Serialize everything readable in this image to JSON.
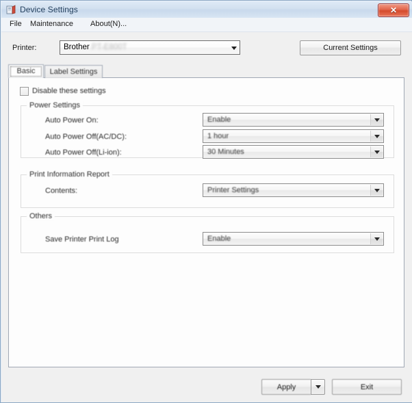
{
  "window": {
    "title": "Device Settings",
    "icon": "printer-icon",
    "close_label": "✕",
    "accent_close_color": "#d44a2d",
    "frame_border_color": "#8ba7c4"
  },
  "menubar": {
    "items": [
      {
        "label": "File",
        "mnemonic": "F"
      },
      {
        "label": "Maintenance",
        "mnemonic": "M"
      },
      {
        "label": "About(N)...",
        "mnemonic": "N"
      }
    ]
  },
  "printer_row": {
    "label": "Printer:",
    "selected": "Brother",
    "model": "PT-E800T",
    "current_settings_button": "Current Settings"
  },
  "tabs": [
    {
      "label": "Basic",
      "selected": true
    },
    {
      "label": "Label Settings",
      "selected": false
    }
  ],
  "panel": {
    "disable_checkbox": {
      "label": "Disable these settings",
      "checked": false
    },
    "groups": [
      {
        "title": "Power Settings",
        "fields": [
          {
            "label": "Auto Power On:",
            "value": "Enable"
          },
          {
            "label": "Auto Power Off(AC/DC):",
            "value": "1 hour"
          },
          {
            "label": "Auto Power Off(Li-ion):",
            "value": "30 Minutes"
          }
        ]
      },
      {
        "title": "Print Information Report",
        "fields": [
          {
            "label": "Contents:",
            "value": "Printer Settings"
          }
        ]
      },
      {
        "title": "Others",
        "fields": [
          {
            "label": "Save Printer Print Log",
            "value": "Enable"
          }
        ]
      }
    ]
  },
  "footer": {
    "apply_label": "Apply",
    "apply_dropdown_icon": "chevron-down-icon",
    "exit_label": "Exit"
  }
}
